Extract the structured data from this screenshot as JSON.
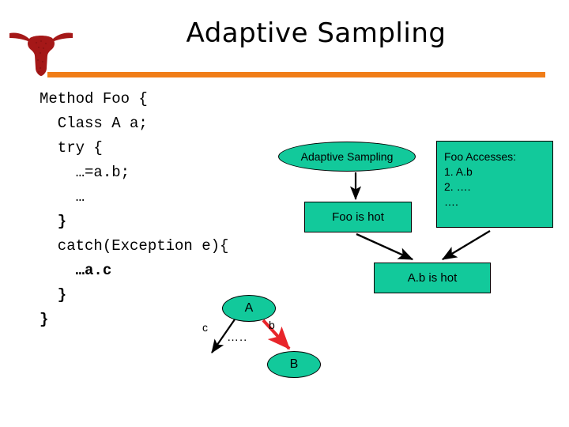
{
  "slide": {
    "title": "Adaptive Sampling",
    "accent_color": "#F07D18",
    "node_fill_color": "#12C99B",
    "hot_edge_color": "#E8252A",
    "logo_color": "#A51818",
    "logo_name": "longhorn-logo"
  },
  "code": {
    "lines": [
      {
        "text": "Method Foo {",
        "indent": 0,
        "bold": false
      },
      {
        "text": "Class A a;",
        "indent": 1,
        "bold": false
      },
      {
        "text": "try {",
        "indent": 1,
        "bold": false
      },
      {
        "text": "…=a.b;",
        "indent": 2,
        "bold": false
      },
      {
        "text": "…",
        "indent": 2,
        "bold": false
      },
      {
        "text": "}",
        "indent": 1,
        "bold": true
      },
      {
        "text": "catch(Exception e){",
        "indent": 1,
        "bold": false
      },
      {
        "text": "…a.c",
        "indent": 2,
        "bold": true
      },
      {
        "text": "}",
        "indent": 1,
        "bold": true
      },
      {
        "text": "}",
        "indent": 0,
        "bold": true
      }
    ]
  },
  "diagram": {
    "adaptive_sampling_node": "Adaptive Sampling",
    "foo_is_hot_node": "Foo is hot",
    "ab_is_hot_node": "A.b is hot",
    "foo_accesses": {
      "heading": "Foo Accesses:",
      "items": [
        "1. A.b",
        "2. ….",
        "…."
      ]
    },
    "call_graph": {
      "node_a": "A",
      "node_b": "B",
      "edge_c_label": "c",
      "edge_b_label": "b",
      "edge_dots_label": "….."
    }
  }
}
